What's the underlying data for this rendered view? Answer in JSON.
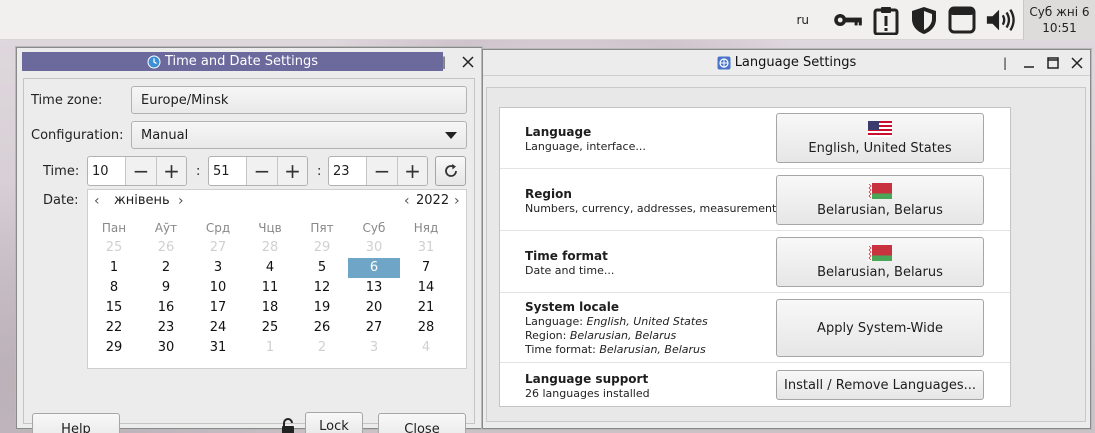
{
  "top_panel": {
    "lang_indicator": "ru",
    "tray_icons": [
      "key-icon",
      "clipboard-alert-icon",
      "shield-icon",
      "window-icon",
      "volume-icon"
    ],
    "clock": {
      "day": "Суб жні  6",
      "time": "10:51"
    }
  },
  "time_date_window": {
    "title": "Time and Date Settings",
    "timezone_label": "Time zone:",
    "timezone_value": "Europe/Minsk",
    "config_label": "Configuration:",
    "config_value": "Manual",
    "time_label": "Time:",
    "hour": "10",
    "minute": "51",
    "second": "23",
    "date_label": "Date:",
    "calendar": {
      "month": "жнівень",
      "year": "2022",
      "weekdays": [
        "Пан",
        "Аўт",
        "Срд",
        "Чцв",
        "Пят",
        "Суб",
        "Няд"
      ],
      "weeks": [
        [
          "25",
          "26",
          "27",
          "28",
          "29",
          "30",
          "31"
        ],
        [
          "1",
          "2",
          "3",
          "4",
          "5",
          "6",
          "7"
        ],
        [
          "8",
          "9",
          "10",
          "11",
          "12",
          "13",
          "14"
        ],
        [
          "15",
          "16",
          "17",
          "18",
          "19",
          "20",
          "21"
        ],
        [
          "22",
          "23",
          "24",
          "25",
          "26",
          "27",
          "28"
        ],
        [
          "29",
          "30",
          "31",
          "1",
          "2",
          "3",
          "4"
        ]
      ],
      "selected": "6"
    },
    "help_label": "Help",
    "lock_label": "Lock",
    "close_label": "Close"
  },
  "language_window": {
    "title": "Language Settings",
    "rows": {
      "language": {
        "title": "Language",
        "subtitle": "Language, interface...",
        "button": "English, United States"
      },
      "region": {
        "title": "Region",
        "subtitle": "Numbers, currency, addresses, measurement...",
        "button": "Belarusian, Belarus"
      },
      "time_format": {
        "title": "Time format",
        "subtitle": "Date and time...",
        "button": "Belarusian, Belarus"
      },
      "system_locale": {
        "title": "System locale",
        "line_language_prefix": "Language: ",
        "line_language_value": "English, United States",
        "line_region_prefix": "Region: ",
        "line_region_value": "Belarusian, Belarus",
        "line_time_prefix": "Time format: ",
        "line_time_value": "Belarusian, Belarus",
        "button": "Apply System-Wide"
      },
      "language_support": {
        "title": "Language support",
        "subtitle": "26 languages installed",
        "button": "Install / Remove Languages..."
      }
    }
  },
  "colors": {
    "titlebar_active": "#6c6a9c",
    "calendar_selected": "#6fa6c8"
  }
}
